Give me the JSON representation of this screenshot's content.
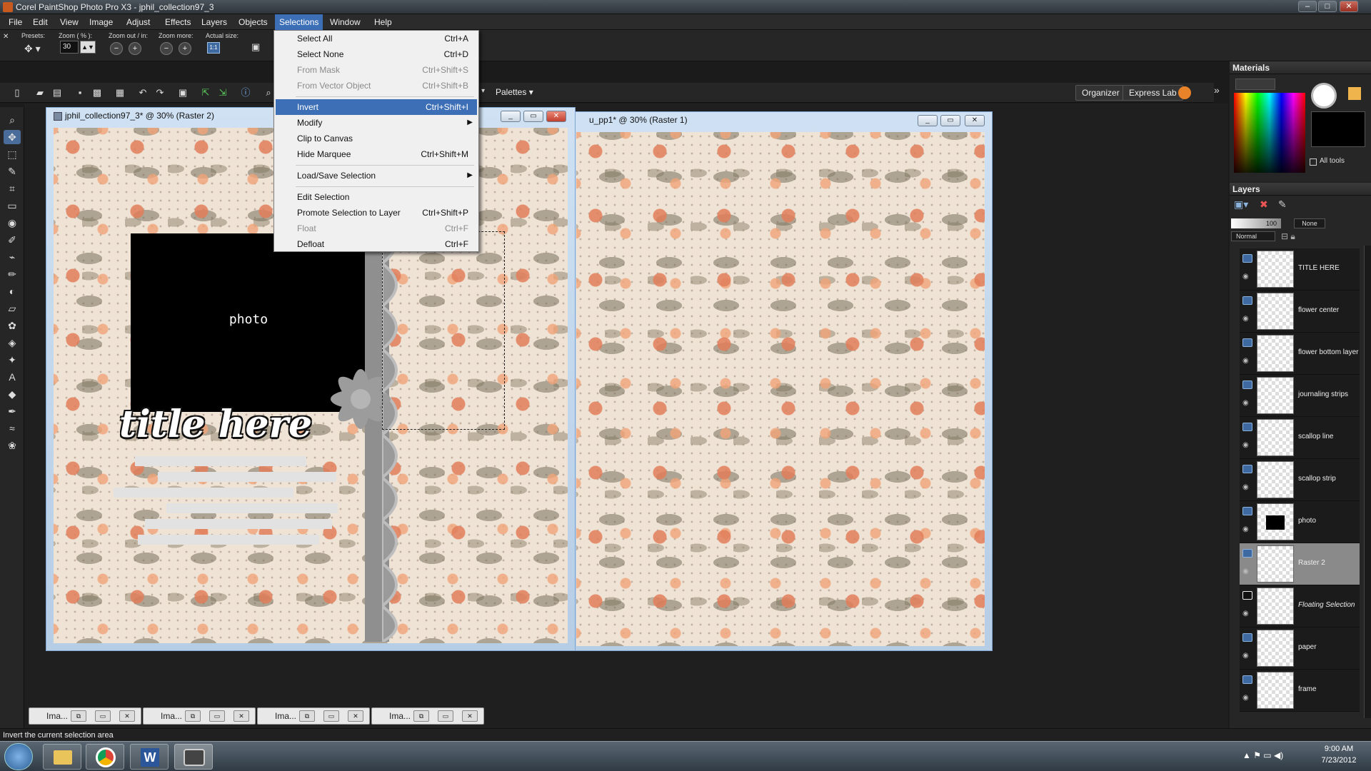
{
  "window": {
    "title": "Corel PaintShop Photo Pro X3 - jphil_collection97_3"
  },
  "menu": [
    "File",
    "Edit",
    "View",
    "Image",
    "Adjust",
    "Effects",
    "Layers",
    "Objects",
    "Selections",
    "Window",
    "Help"
  ],
  "options_bar": {
    "presets_label": "Presets:",
    "zoom_label": "Zoom ( % ):",
    "zoom_value": "30",
    "zoom_out_in_label": "Zoom out / in:",
    "zoom_more_label": "Zoom more:",
    "actual_size_label": "Actual size:",
    "actual_size_icon": "1:1"
  },
  "standard_bar": {
    "palettes_label": "Palettes",
    "organizer_label": "Organizer",
    "express_lab_label": "Express Lab"
  },
  "selections_menu": {
    "items": [
      {
        "label": "Select All",
        "shortcut": "Ctrl+A",
        "disabled": false
      },
      {
        "label": "Select None",
        "shortcut": "Ctrl+D",
        "disabled": false
      },
      {
        "label": "From Mask",
        "shortcut": "Ctrl+Shift+S",
        "disabled": true
      },
      {
        "label": "From Vector Object",
        "shortcut": "Ctrl+Shift+B",
        "disabled": true
      },
      {
        "label": "Invert",
        "shortcut": "Ctrl+Shift+I",
        "highlighted": true
      },
      {
        "label": "Modify",
        "submenu": true
      },
      {
        "label": "Clip to Canvas",
        "shortcut": ""
      },
      {
        "label": "Hide Marquee",
        "shortcut": "Ctrl+Shift+M"
      },
      {
        "label": "Load/Save Selection",
        "submenu": true
      },
      {
        "label": "Edit Selection",
        "shortcut": ""
      },
      {
        "label": "Promote Selection to Layer",
        "shortcut": "Ctrl+Shift+P"
      },
      {
        "label": "Float",
        "shortcut": "Ctrl+F",
        "disabled": true
      },
      {
        "label": "Defloat",
        "shortcut": "Ctrl+F"
      }
    ]
  },
  "doc1": {
    "title": "jphil_collection97_3* @  30% (Raster 2)",
    "photo_label": "photo",
    "title_art": "title here"
  },
  "doc2": {
    "title": "u_pp1* @  30% (Raster 1)"
  },
  "materials": {
    "title": "Materials",
    "all_tools_label": "All tools"
  },
  "layers": {
    "title": "Layers",
    "opacity": "100",
    "mask_label": "None",
    "blend_mode": "Normal",
    "items": [
      {
        "name": "TITLE HERE"
      },
      {
        "name": "flower center"
      },
      {
        "name": "flower bottom layer"
      },
      {
        "name": "journaling strips"
      },
      {
        "name": "scallop line"
      },
      {
        "name": "scallop strip"
      },
      {
        "name": "photo"
      },
      {
        "name": "Raster 2",
        "selected": true
      },
      {
        "name": "Floating Selection"
      },
      {
        "name": "paper"
      },
      {
        "name": "frame"
      }
    ]
  },
  "minimized_windows": [
    "Ima...",
    "Ima...",
    "Ima...",
    "Ima..."
  ],
  "status": {
    "text": "Invert the current selection area"
  },
  "taskbar": {
    "time": "9:00 AM",
    "date": "7/23/2012"
  },
  "colors": {
    "menu_highlight": "#3d6fb7",
    "selected_layer": "#8a8a8a",
    "paper_bg": "#efe3d6"
  }
}
